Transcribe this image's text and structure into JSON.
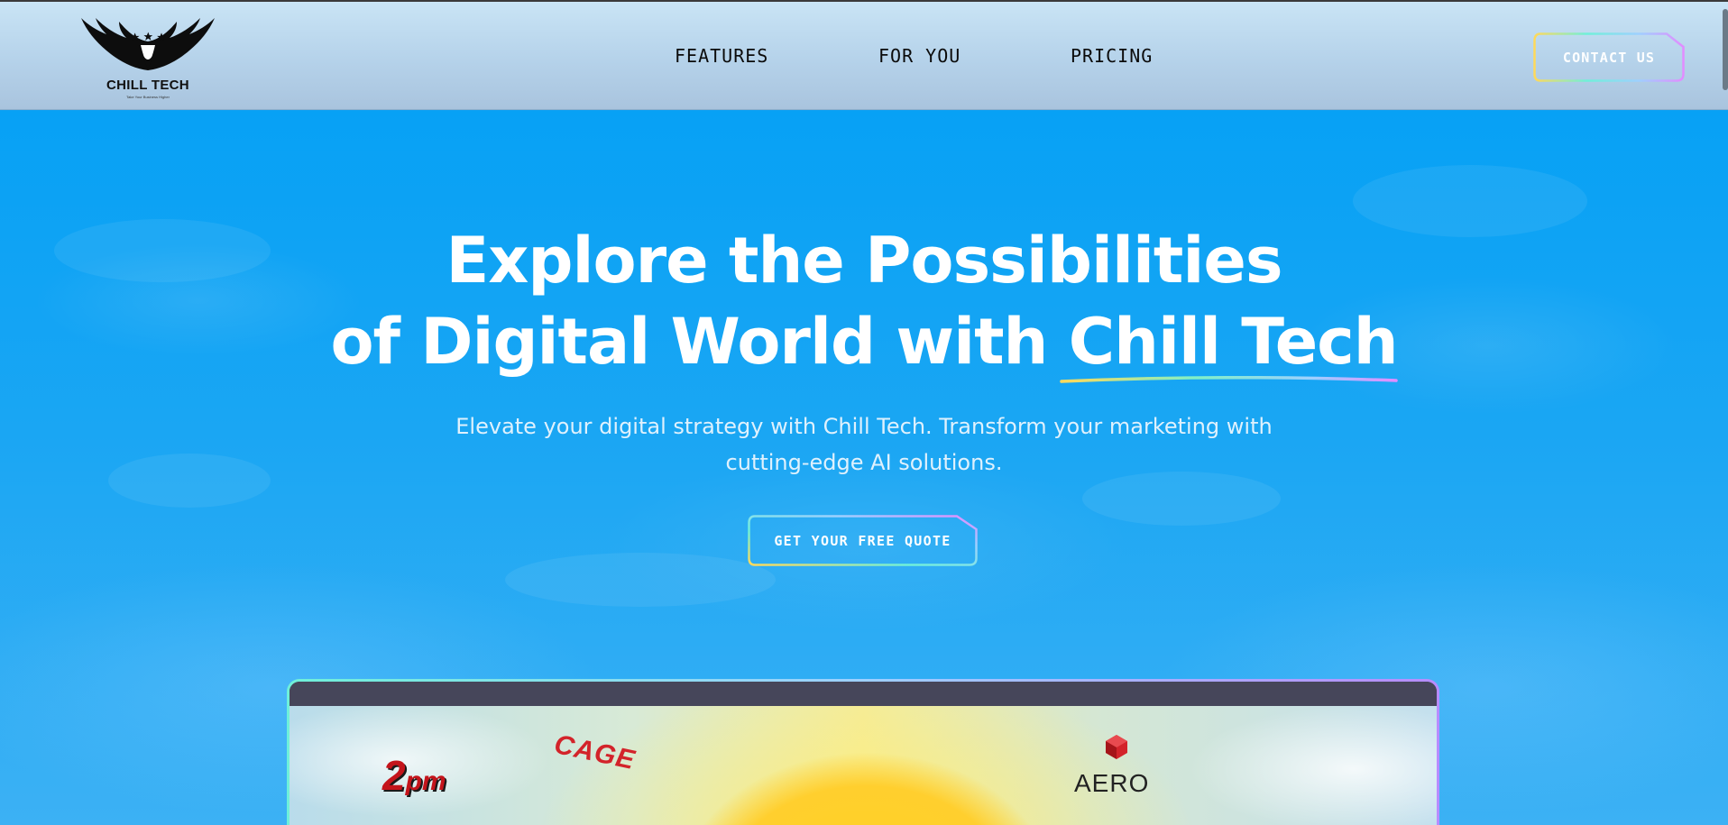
{
  "header": {
    "logo_text": "CHILL TECH",
    "logo_tagline": "Take Your Business Higher",
    "nav": [
      {
        "label": "FEATURES"
      },
      {
        "label": "FOR YOU"
      },
      {
        "label": "PRICING"
      }
    ],
    "contact_label": "CONTACT US"
  },
  "hero": {
    "headline_line1": "Explore the Possibilities",
    "headline_line2": "of Digital World with Chill Tech",
    "subtext_line1": "Elevate your digital strategy with Chill Tech. Transform your marketing with",
    "subtext_line2": "cutting-edge AI solutions.",
    "cta_label": "GET YOUR FREE QUOTE"
  },
  "preview": {
    "brands": [
      {
        "name": "2pm",
        "text_a": "2",
        "text_b": "pm"
      },
      {
        "name": "CAGE",
        "text": "CAGE"
      },
      {
        "name": "AERO",
        "text": "AERO"
      }
    ]
  },
  "colors": {
    "hero_bg": "#0ea0f2",
    "header_bg": "#c9e4f5",
    "button_gradient": [
      "#ffd95a",
      "#6ff0d9",
      "#9ed0ff",
      "#e28cff"
    ]
  }
}
